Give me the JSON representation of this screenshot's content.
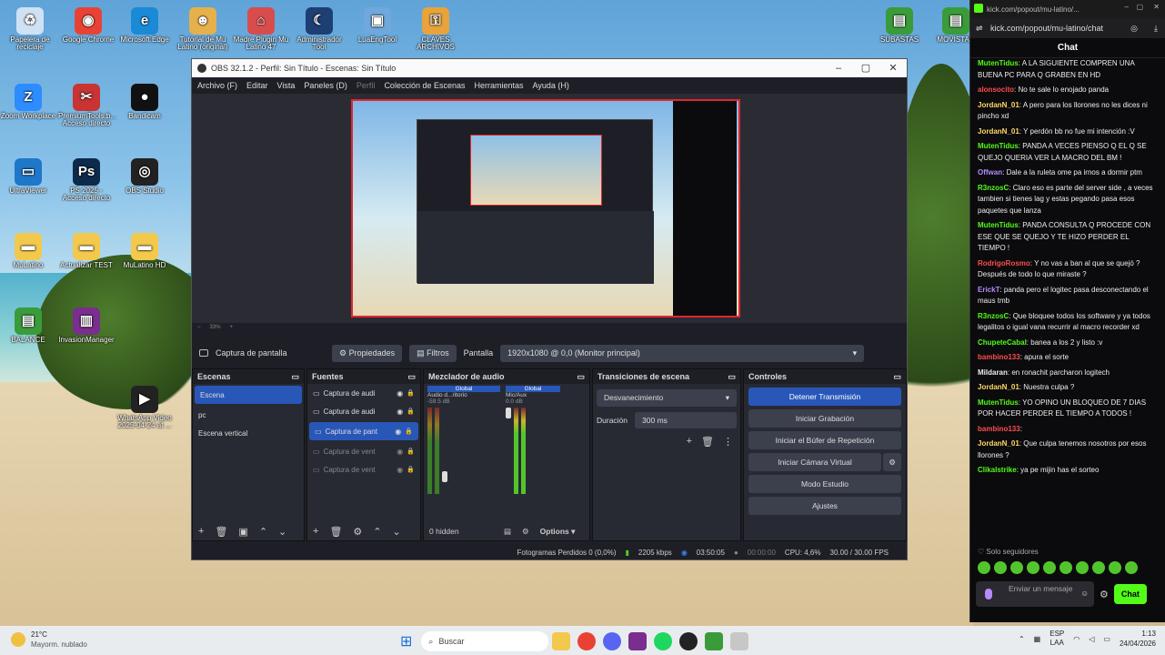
{
  "desktop": {
    "icons": [
      {
        "label": "Papelera de reciclaje",
        "icon": "recycle-bin-icon",
        "color": "#cfe2f3",
        "glyph": "♻"
      },
      {
        "label": "Google Chrome",
        "icon": "chrome-icon",
        "color": "#e94235",
        "glyph": "◉"
      },
      {
        "label": "Microsoft Edge",
        "icon": "edge-icon",
        "color": "#1a8ad6",
        "glyph": "e"
      },
      {
        "label": "Tutorial de Mu Latino (original)",
        "icon": "user-icon",
        "color": "#e6b04a",
        "glyph": "☻"
      },
      {
        "label": "Madre Plugin Mu Latino 47",
        "icon": "home-icon",
        "color": "#d94c4c",
        "glyph": "⌂"
      },
      {
        "label": "Administrador Tool",
        "icon": "moon-icon",
        "color": "#1d3f74",
        "glyph": "☾"
      },
      {
        "label": "LuaEngTool",
        "icon": "tool-icon",
        "color": "#6fa8dc",
        "glyph": "▣"
      },
      {
        "label": "CLAVES ARCHIVOS",
        "icon": "key-icon",
        "color": "#e8a33a",
        "glyph": "⚿"
      },
      {
        "label": "Zoom Workplace",
        "icon": "zoom-icon",
        "color": "#2d8cff",
        "glyph": "Z"
      },
      {
        "label": "PremiumTools.b... Acceso directo",
        "icon": "tools-icon",
        "color": "#c93333",
        "glyph": "✂"
      },
      {
        "label": "Bandicam",
        "icon": "record-icon",
        "color": "#111",
        "glyph": "●"
      },
      {
        "label": "UltraViewer",
        "icon": "monitor-icon",
        "color": "#1f77c9",
        "glyph": "▭"
      },
      {
        "label": "PS 2025 - Acceso directo",
        "icon": "photoshop-icon",
        "color": "#0d2a4a",
        "glyph": "Ps"
      },
      {
        "label": "OBS Studio",
        "icon": "obs-icon",
        "color": "#222",
        "glyph": "◎"
      },
      {
        "label": "MuLatino",
        "icon": "folder-icon",
        "color": "#f2c94c",
        "glyph": "▬"
      },
      {
        "label": "Actualizar TEST",
        "icon": "folder-icon",
        "color": "#f2c94c",
        "glyph": "▬"
      },
      {
        "label": "MuLatino HD",
        "icon": "folder-icon",
        "color": "#f2c94c",
        "glyph": "▬"
      },
      {
        "label": "BALANCE",
        "icon": "app-icon",
        "color": "#3a9b3a",
        "glyph": "▤"
      },
      {
        "label": "InvasionManager",
        "icon": "winrar-icon",
        "color": "#7a2e8e",
        "glyph": "▥"
      },
      {
        "label": "WhatsApp Video 2025-04-24 at ...",
        "icon": "video-icon",
        "color": "#222",
        "glyph": "▶"
      },
      {
        "label": "SUBASTAS",
        "icon": "app-icon",
        "color": "#3a9b3a",
        "glyph": "▤"
      },
      {
        "label": "MOVISTAR",
        "icon": "app-icon",
        "color": "#3a9b3a",
        "glyph": "▤"
      }
    ]
  },
  "obs": {
    "title": "OBS 32.1.2 - Perfil: Sin Título - Escenas: Sin Título",
    "menu": [
      "Archivo (F)",
      "Editar",
      "Vista",
      "Paneles (D)",
      "Perfil",
      "Colección de Escenas",
      "Herramientas",
      "Ayuda (H)"
    ],
    "source_toolbar": {
      "source_name": "Captura de pantalla",
      "properties": "Propiedades",
      "filters": "Filtros",
      "screen_label": "Pantalla",
      "screen_value": "1920x1080 @ 0,0 (Monitor principal)"
    },
    "scenes": {
      "title": "Escenas",
      "items": [
        "Escena",
        "pc",
        "Escena vertical"
      ],
      "selected": 0
    },
    "sources": {
      "title": "Fuentes",
      "items": [
        "Captura de audi",
        "Captura de audi",
        "Captura de pant",
        "Captura de vent",
        "Captura de vent"
      ],
      "selected": 2
    },
    "mixer": {
      "title": "Mezclador de audio",
      "channels": [
        {
          "name": "Audio d...ritorio",
          "level": "-59.5 dB",
          "tag": "Global"
        },
        {
          "name": "Mic/Aux",
          "level": "0.0 dB",
          "tag": "Global"
        }
      ],
      "hidden": "0 hidden",
      "options": "Options"
    },
    "transitions": {
      "title": "Transiciones de escena",
      "type": "Desvanecimiento",
      "duration_label": "Duración",
      "duration": "300 ms"
    },
    "controls": {
      "title": "Controles",
      "buttons": [
        "Detener Transmisión",
        "Iniciar Grabación",
        "Iniciar el Búfer de Repetición",
        "Iniciar Cámara Virtual",
        "Modo Estudio",
        "Ajustes"
      ]
    },
    "status": {
      "dropped": "Fotogramas Perdidos 0 (0,0%)",
      "bitrate": "2205 kbps",
      "stream_time": "03:50:05",
      "rec_time": "00:00:00",
      "cpu": "CPU: 4,6%",
      "fps": "30.00 / 30.00 FPS"
    },
    "zoom": "33%"
  },
  "chat": {
    "window_url": "kick.com/popout/mu-latino/...",
    "url": "kick.com/popout/mu-latino/chat",
    "title": "Chat",
    "messages": [
      {
        "user": "MutenTidus",
        "color": "#53fc18",
        "text": "A LA SIGUIENTE COMPREN UNA BUENA PC PARA Q GRABEN EN HD"
      },
      {
        "user": "alonsocito",
        "color": "#ff4d4d",
        "text": "No te sale lo enojado panda"
      },
      {
        "user": "JordanN_01",
        "color": "#ffd966",
        "text": "A pero para los llorones no les dices ni pincho xd"
      },
      {
        "user": "JordanN_01",
        "color": "#ffd966",
        "text": "Y perdón bb no fue mi intención :V"
      },
      {
        "user": "MutenTidus",
        "color": "#53fc18",
        "text": "PANDA A VECES PIENSO Q EL Q SE QUEJO QUERIA VER LA MACRO DEL BM !"
      },
      {
        "user": "Offwan",
        "color": "#b58cff",
        "text": "Dale a la ruleta ome pa irnos a dormir ptm"
      },
      {
        "user": "R3nzosC",
        "color": "#53fc18",
        "text": "Claro eso es parte del server side , a veces tambien si tienes lag y estas pegando pasa esos paquetes que lanza"
      },
      {
        "user": "MutenTidus",
        "color": "#53fc18",
        "text": "PANDA CONSULTA Q PROCEDE CON ESE QUE SE QUEJO Y TE HIZO PERDER EL TIEMPO !"
      },
      {
        "user": "RodrigoRosmo",
        "color": "#ff4d4d",
        "text": "Y no vas a ban al que se quejó ? Después de todo lo que miraste ?"
      },
      {
        "user": "ErickT",
        "color": "#b58cff",
        "text": "panda pero el logitec pasa desconectando el maus tmb"
      },
      {
        "user": "R3nzosC",
        "color": "#53fc18",
        "text": "Que bloquee todos los software y ya todos legalitos o igual vana recurrir al macro recorder xd"
      },
      {
        "user": "ChupeteCabal",
        "color": "#53fc18",
        "text": "banea a los 2 y listo :v"
      },
      {
        "user": "bambino133",
        "color": "#ff4d4d",
        "text": "apura el sorte"
      },
      {
        "user": "Mildaran",
        "color": "#eeeeee",
        "text": "en ronachit parcharon logitech"
      },
      {
        "user": "JordanN_01",
        "color": "#ffd966",
        "text": "Nuestra culpa ?"
      },
      {
        "user": "MutenTidus",
        "color": "#53fc18",
        "text": "YO OPINO UN BLOQUEO DE 7 DIAS POR HACER PERDER EL TIEMPO A TODOS !"
      },
      {
        "user": "bambino133",
        "color": "#ff4d4d",
        "text": ""
      },
      {
        "user": "JordanN_01",
        "color": "#ffd966",
        "text": "Que culpa tenemos nosotros por esos llorones ?"
      },
      {
        "user": "Clikalstrike",
        "color": "#53fc18",
        "text": "ya pe mijin has el sorteo"
      }
    ],
    "followers_only": "Solo seguidores",
    "input_placeholder": "Enviar un mensaje",
    "send_label": "Chat"
  },
  "taskbar": {
    "weather_temp": "21°C",
    "weather_desc": "Mayorm. nublado",
    "search_placeholder": "Buscar",
    "lang": "ESP",
    "lang_sub": "LAA",
    "time": "1:13",
    "date": "24/04/2026"
  }
}
